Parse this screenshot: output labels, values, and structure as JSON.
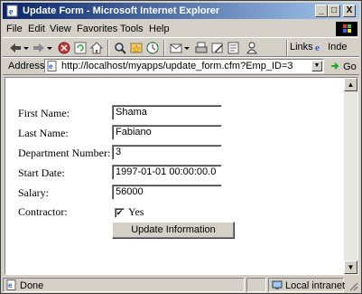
{
  "window": {
    "title": "Update Form - Microsoft Internet Explorer",
    "controls": {
      "minimize": "_",
      "maximize": "□",
      "close": "X"
    }
  },
  "menu": [
    "File",
    "Edit",
    "View",
    "Favorites",
    "Tools",
    "Help"
  ],
  "toolbar": {
    "links_label": "Links",
    "links_item": "Inde"
  },
  "address": {
    "label": "Address",
    "url": "http://localhost/myapps/update_form.cfm?Emp_ID=3",
    "go_label": "Go"
  },
  "form": {
    "first_name_label": "First Name:",
    "first_name_value": "Shama",
    "last_name_label": "Last Name:",
    "last_name_value": "Fabiano",
    "department_label": "Department Number:",
    "department_value": "3",
    "start_date_label": "Start Date:",
    "start_date_value": "1997-01-01 00:00:00.0",
    "salary_label": "Salary:",
    "salary_value": "56000",
    "contractor_label": "Contractor:",
    "contractor_checked": true,
    "contractor_option": "Yes",
    "submit_label": "Update Information"
  },
  "status": {
    "text": "Done",
    "zone": "Local intranet"
  }
}
